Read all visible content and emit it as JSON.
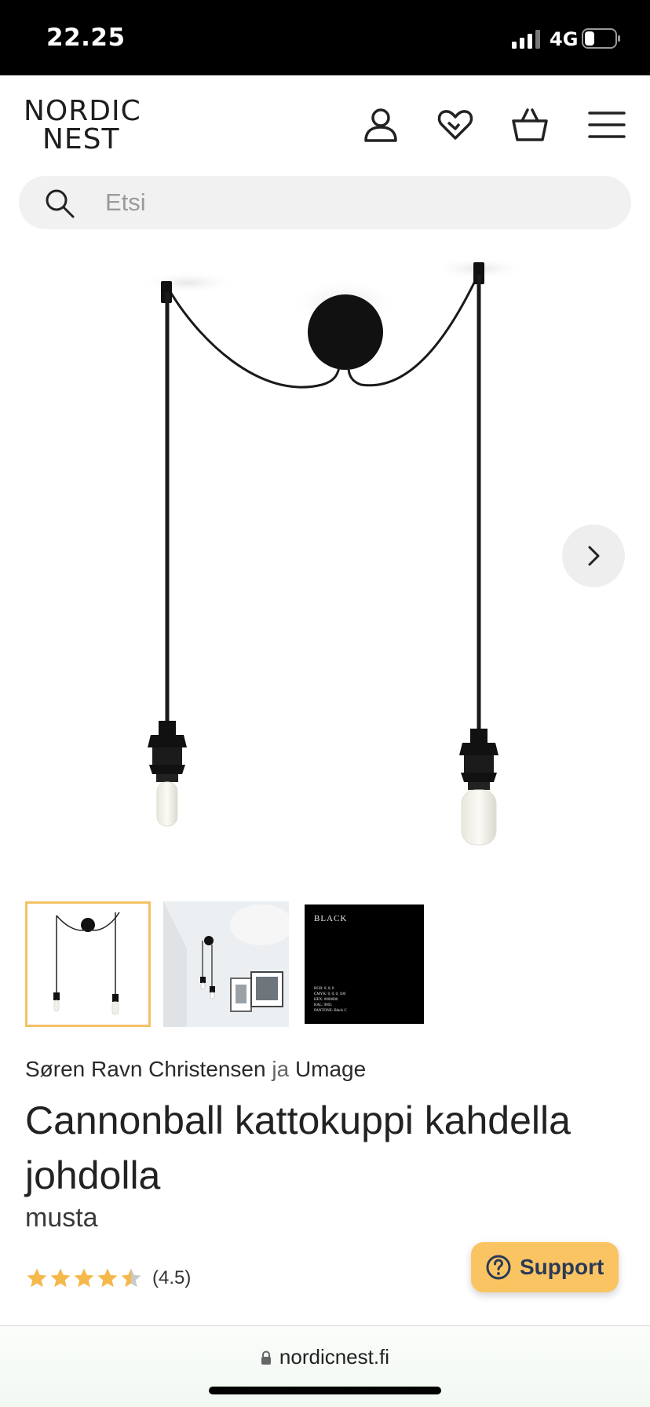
{
  "status_bar": {
    "time": "22.25",
    "network": "4G"
  },
  "header": {
    "logo_line1": "NORDIC",
    "logo_line2": "NEST",
    "icons": [
      "account-icon",
      "wishlist-heart-icon",
      "cart-basket-icon",
      "menu-hamburger-icon"
    ]
  },
  "search": {
    "placeholder": "Etsi",
    "value": ""
  },
  "gallery": {
    "thumbnails": [
      {
        "name": "thumbnail-product",
        "selected": true
      },
      {
        "name": "thumbnail-room"
      },
      {
        "name": "thumbnail-color-swatch",
        "title": "BLACK",
        "spec_lines": [
          "RGB: 0, 0, 0",
          "CMYK: 0, 0, 0, 100",
          "HEX: #000000",
          "RAL: 9005",
          "PANTONE: Black C"
        ]
      }
    ]
  },
  "product": {
    "designer": "Søren Ravn Christensen",
    "connector": "ja",
    "brand": "Umage",
    "title": "Cannonball kattokuppi kahdella johdolla",
    "variant": "musta",
    "rating": 4.5,
    "rating_text": "(4.5)"
  },
  "support": {
    "label": "Support"
  },
  "browser": {
    "url": "nordicnest.fi"
  },
  "colors": {
    "accent": "#f3c265",
    "support_bg": "#fbc463",
    "star": "#f5b84a"
  }
}
